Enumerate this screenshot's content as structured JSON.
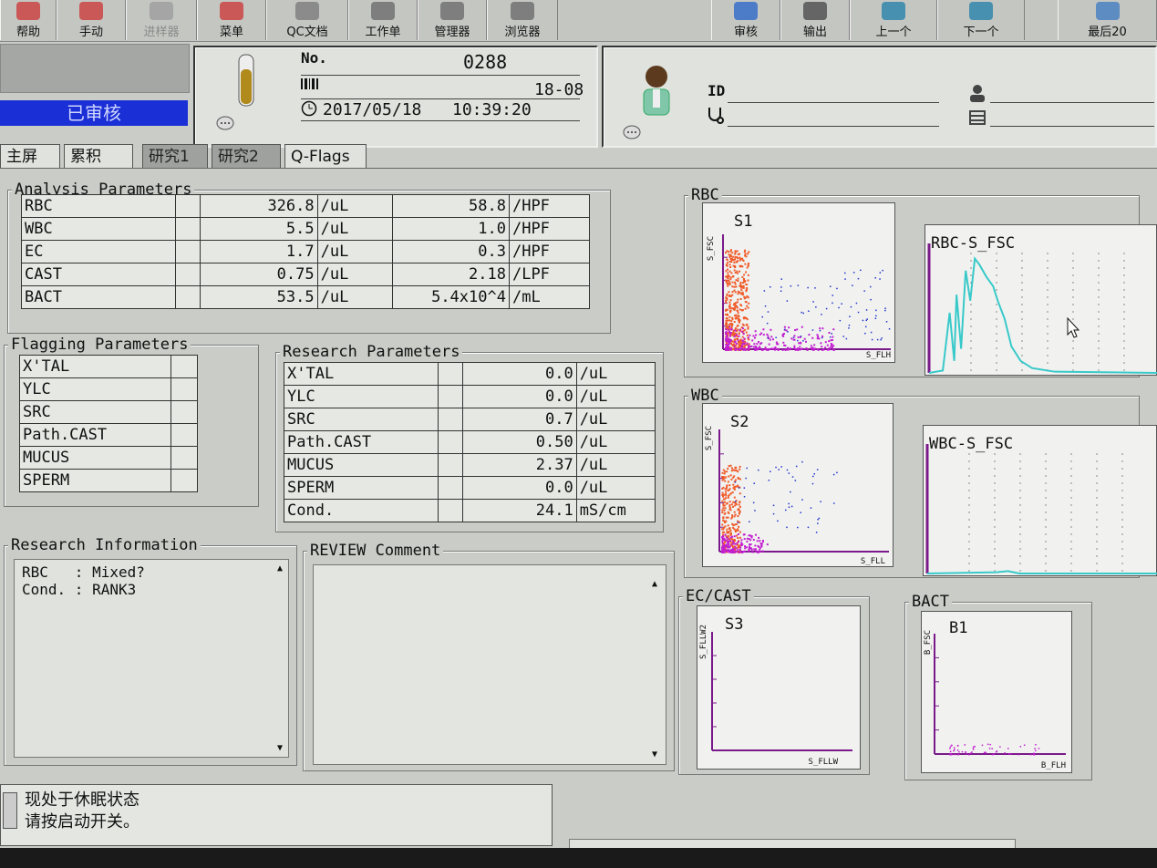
{
  "toolbar": {
    "buttons": [
      {
        "label": "帮助",
        "icon": "help-icon",
        "enabled": true
      },
      {
        "label": "手动",
        "icon": "manual-icon",
        "enabled": true
      },
      {
        "label": "进样器",
        "icon": "sampler-icon",
        "enabled": false
      },
      {
        "label": "菜单",
        "icon": "menu-icon",
        "enabled": true
      },
      {
        "label": "QC文档",
        "icon": "qc-doc-icon",
        "enabled": true
      },
      {
        "label": "工作单",
        "icon": "worklist-icon",
        "enabled": true
      },
      {
        "label": "管理器",
        "icon": "manager-icon",
        "enabled": true
      },
      {
        "label": "浏览器",
        "icon": "browser-icon",
        "enabled": true
      },
      {
        "label": "审核",
        "icon": "validate-icon",
        "enabled": true
      },
      {
        "label": "输出",
        "icon": "output-icon",
        "enabled": true
      },
      {
        "label": "上一个",
        "icon": "previous-icon",
        "enabled": true
      },
      {
        "label": "下一个",
        "icon": "next-icon",
        "enabled": true
      },
      {
        "label": "最后20",
        "icon": "last20-icon",
        "enabled": true
      }
    ]
  },
  "header": {
    "status": "已审核",
    "sample": {
      "no_label": "No.",
      "no_value": "0288",
      "rack_value": "18-08",
      "date": "2017/05/18",
      "time": "10:39:20"
    },
    "patient": {
      "id_label": "ID",
      "id_value": "",
      "name_value": ""
    }
  },
  "tabs": [
    {
      "label": "主屏",
      "active": true
    },
    {
      "label": "累积",
      "active": true
    },
    {
      "label": "研究1",
      "active": false
    },
    {
      "label": "研究2",
      "active": false
    },
    {
      "label": "Q-Flags",
      "active": true
    }
  ],
  "analysis": {
    "title": "Analysis Parameters",
    "rows": [
      {
        "name": "RBC",
        "value": "326.8",
        "unit": "/uL",
        "value2": "58.8",
        "unit2": "/HPF"
      },
      {
        "name": "WBC",
        "value": "5.5",
        "unit": "/uL",
        "value2": "1.0",
        "unit2": "/HPF"
      },
      {
        "name": "EC",
        "value": "1.7",
        "unit": "/uL",
        "value2": "0.3",
        "unit2": "/HPF"
      },
      {
        "name": "CAST",
        "value": "0.75",
        "unit": "/uL",
        "value2": "2.18",
        "unit2": "/LPF"
      },
      {
        "name": "BACT",
        "value": "53.5",
        "unit": "/uL",
        "value2": "5.4x10^4",
        "unit2": "/mL"
      }
    ]
  },
  "flagging": {
    "title": "Flagging Parameters",
    "rows": [
      "X'TAL",
      "YLC",
      "SRC",
      "Path.CAST",
      "MUCUS",
      "SPERM"
    ]
  },
  "research": {
    "title": "Research Parameters",
    "rows": [
      {
        "name": "X'TAL",
        "value": "0.0",
        "unit": "/uL"
      },
      {
        "name": "YLC",
        "value": "0.0",
        "unit": "/uL"
      },
      {
        "name": "SRC",
        "value": "0.7",
        "unit": "/uL"
      },
      {
        "name": "Path.CAST",
        "value": "0.50",
        "unit": "/uL"
      },
      {
        "name": "MUCUS",
        "value": "2.37",
        "unit": "/uL"
      },
      {
        "name": "SPERM",
        "value": "0.0",
        "unit": "/uL"
      },
      {
        "name": "Cond.",
        "value": "24.1",
        "unit": "mS/cm"
      }
    ]
  },
  "research_info": {
    "title": "Research Information",
    "lines": [
      "RBC   : Mixed?",
      "Cond. : RANK3"
    ]
  },
  "review": {
    "title": "REVIEW Comment",
    "text": ""
  },
  "status_message": {
    "line1": "现处于休眠状态",
    "line2": "请按启动开关。"
  },
  "charts": {
    "rbc_group": "RBC",
    "wbc_group": "WBC",
    "ec_group": "EC/CAST",
    "bact_group": "BACT",
    "s1": {
      "title": "S1",
      "ylabel": "S_FSC",
      "xlabel": "S_FLH"
    },
    "s2": {
      "title": "S2",
      "ylabel": "S_FSC",
      "xlabel": "S_FLL"
    },
    "s3": {
      "title": "S3",
      "ylabel": "S_FLLW2",
      "xlabel": "S_FLLW"
    },
    "b1": {
      "title": "B1",
      "ylabel": "B_FSC",
      "xlabel": "B_FLH"
    },
    "rbc_hist": {
      "title": "RBC-S_FSC"
    },
    "wbc_hist": {
      "title": "WBC-S_FSC"
    }
  },
  "colors": {
    "status_bar": "#1b2fd6",
    "axis": "#7a1a8a",
    "hist_line": "#38c9c9",
    "scatter_orange": "#f05a28",
    "scatter_magenta": "#c21fd0",
    "scatter_blue": "#2233cc"
  }
}
